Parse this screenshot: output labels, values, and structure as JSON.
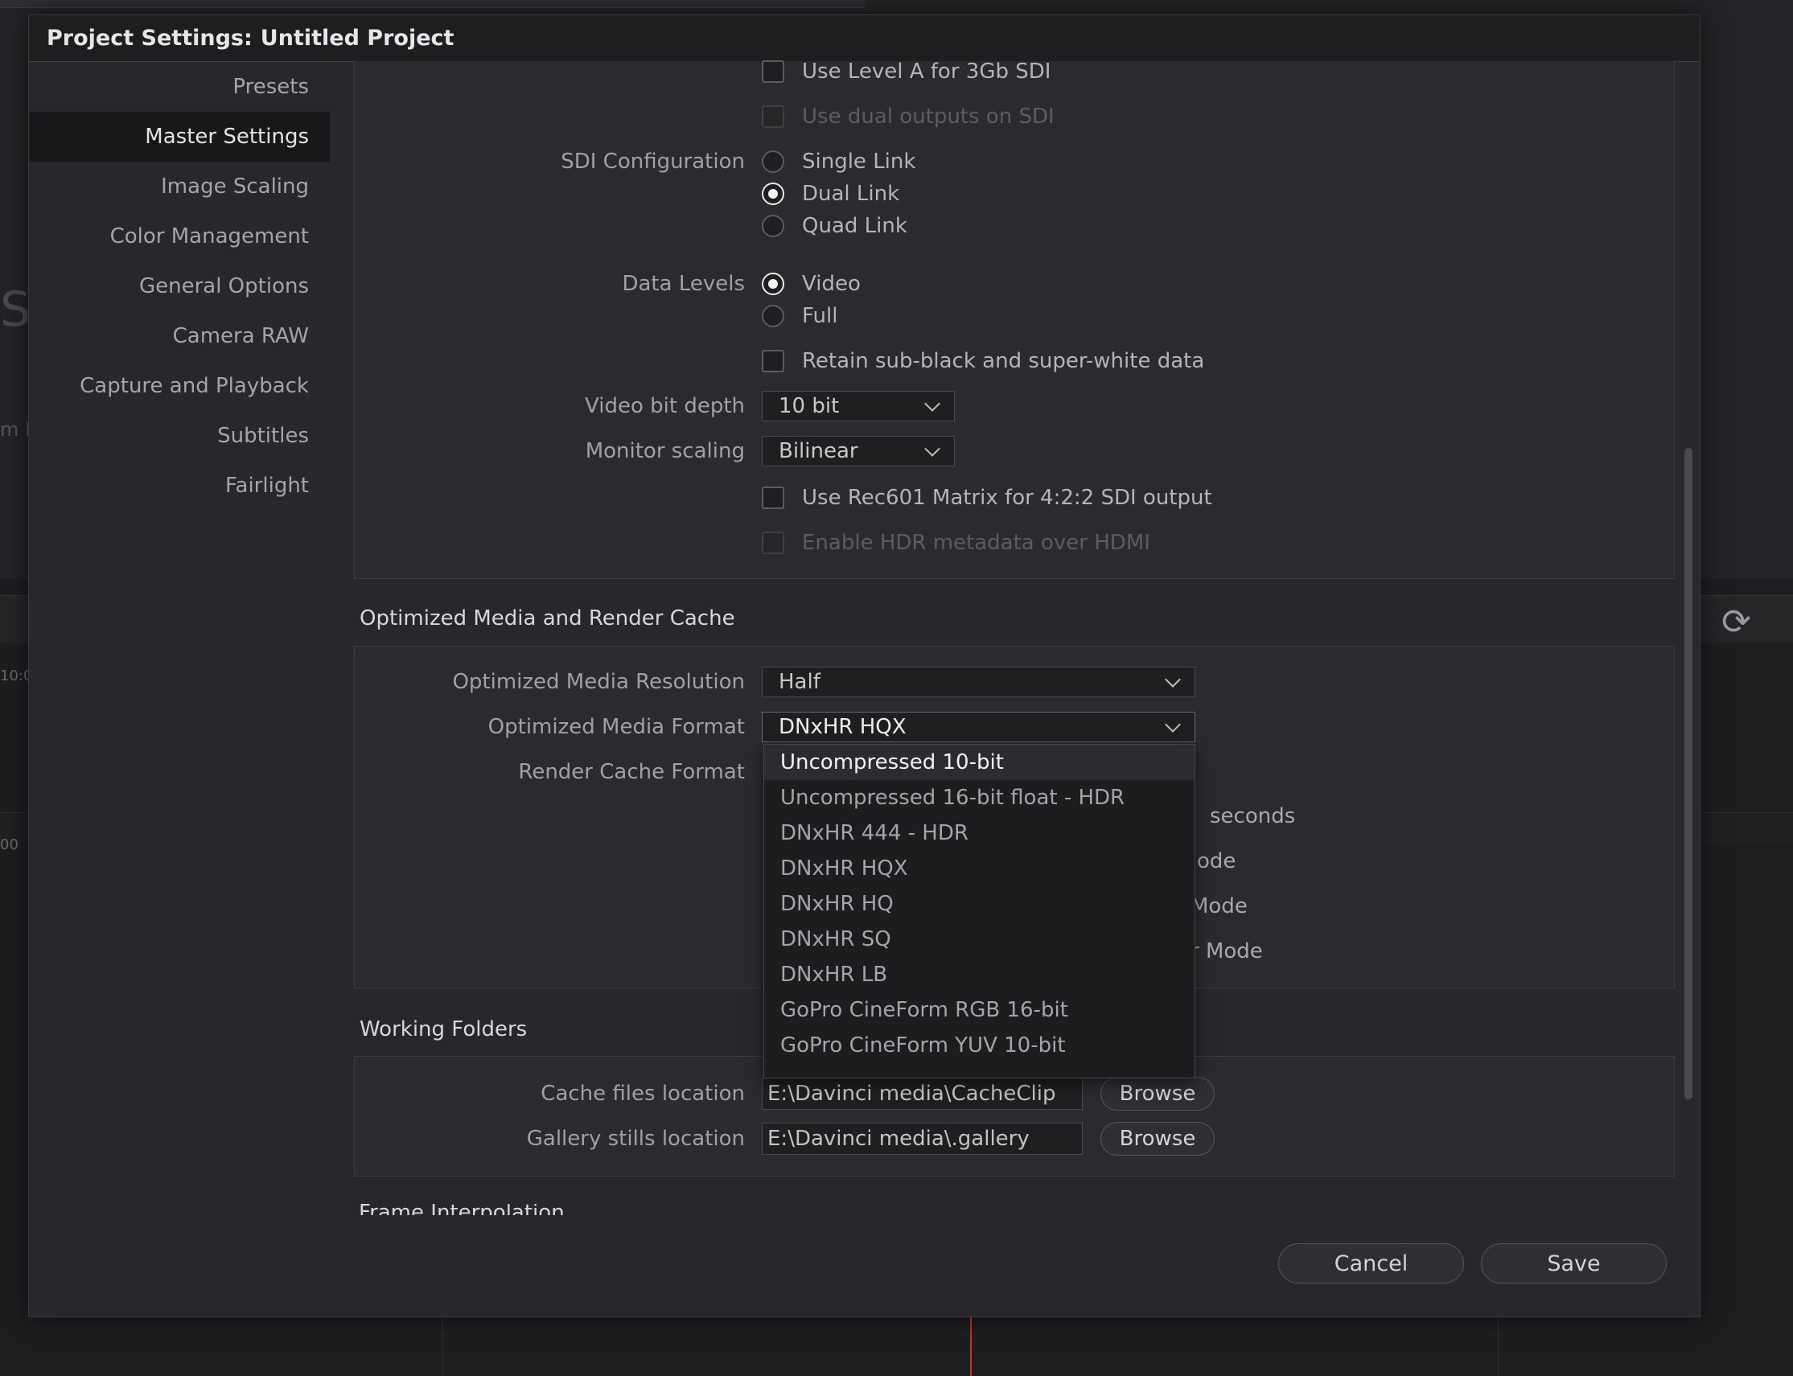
{
  "dialog": {
    "title_prefix": "Project Settings:",
    "title_project": "Untitled Project"
  },
  "sidebar": {
    "items": [
      {
        "label": "Presets",
        "active": false
      },
      {
        "label": "Master Settings",
        "active": true
      },
      {
        "label": "Image Scaling",
        "active": false
      },
      {
        "label": "Color Management",
        "active": false
      },
      {
        "label": "General Options",
        "active": false
      },
      {
        "label": "Camera RAW",
        "active": false
      },
      {
        "label": "Capture and Playback",
        "active": false
      },
      {
        "label": "Subtitles",
        "active": false
      },
      {
        "label": "Fairlight",
        "active": false
      }
    ]
  },
  "video_monitoring": {
    "use_level_a": {
      "label": "Use Level A for 3Gb SDI",
      "checked": false
    },
    "use_dual_outputs": {
      "label": "Use dual outputs on SDI",
      "checked": false,
      "disabled": true
    },
    "sdi_configuration": {
      "label": "SDI Configuration",
      "options": [
        "Single Link",
        "Dual Link",
        "Quad Link"
      ],
      "selected": "Dual Link"
    },
    "data_levels": {
      "label": "Data Levels",
      "options": [
        "Video",
        "Full"
      ],
      "selected": "Video"
    },
    "retain_sub_black": {
      "label": "Retain sub-black and super-white data",
      "checked": false
    },
    "video_bit_depth": {
      "label": "Video bit depth",
      "value": "10 bit"
    },
    "monitor_scaling": {
      "label": "Monitor scaling",
      "value": "Bilinear"
    },
    "use_rec601": {
      "label": "Use Rec601 Matrix for 4:2:2 SDI output",
      "checked": false
    },
    "enable_hdr": {
      "label": "Enable HDR metadata over HDMI",
      "checked": false,
      "disabled": true
    }
  },
  "optimized_media": {
    "title": "Optimized Media and Render Cache",
    "resolution": {
      "label": "Optimized Media Resolution",
      "value": "Half"
    },
    "format": {
      "label": "Optimized Media Format",
      "value": "DNxHR HQX"
    },
    "render_cache_format": {
      "label": "Render Cache Format"
    },
    "obscured_fragments": [
      "seconds",
      "ode",
      "Mode",
      "r Mode"
    ],
    "format_options": [
      "Uncompressed 10-bit",
      "Uncompressed 16-bit float - HDR",
      "DNxHR 444 - HDR",
      "DNxHR HQX",
      "DNxHR HQ",
      "DNxHR SQ",
      "DNxHR LB",
      "GoPro CineForm RGB 16-bit",
      "GoPro CineForm YUV 10-bit"
    ],
    "highlighted_option": "Uncompressed 10-bit"
  },
  "working_folders": {
    "title": "Working Folders",
    "cache": {
      "label": "Cache files location",
      "value": "E:\\Davinci media\\CacheClip",
      "button": "Browse"
    },
    "gallery": {
      "label": "Gallery stills location",
      "value": "E:\\Davinci media\\.gallery",
      "button": "Browse"
    }
  },
  "frame_interpolation": {
    "title": "Frame Interpolation"
  },
  "footer": {
    "cancel": "Cancel",
    "save": "Save"
  },
  "background": {
    "big_letter": "S",
    "fragment": "m N",
    "timecode_a": "10:0",
    "timecode_b": "00"
  },
  "colors": {
    "accent": "#e8e8ea",
    "panel": "#2b2b2f",
    "playhead": "#c0392b"
  }
}
